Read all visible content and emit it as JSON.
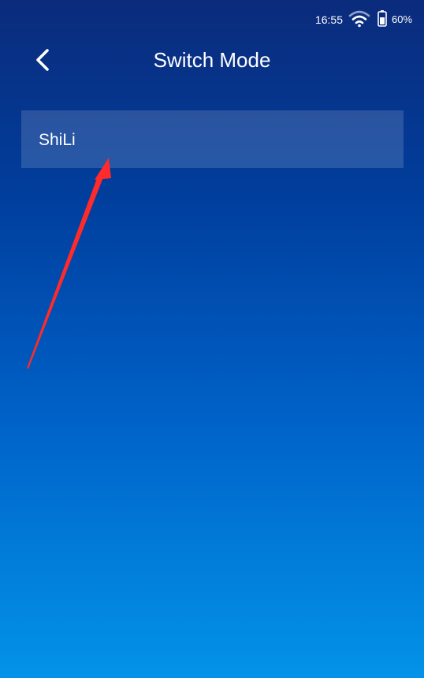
{
  "status_bar": {
    "time": "16:55",
    "battery": "60%",
    "icons": [
      "wifi-icon",
      "battery-icon"
    ]
  },
  "header": {
    "back_icon": "chevron-left-icon",
    "title": "Switch Mode"
  },
  "modes": {
    "items": [
      {
        "label": "ShiLi"
      }
    ]
  },
  "annotation": {
    "icon": "red-arrow-annotation",
    "color": "#ff2a2a"
  },
  "colors": {
    "background_top": "#0b2b7c",
    "background_bottom": "#0293e8",
    "item_background": "rgba(255,255,255,0.15)",
    "text": "#ffffff"
  }
}
